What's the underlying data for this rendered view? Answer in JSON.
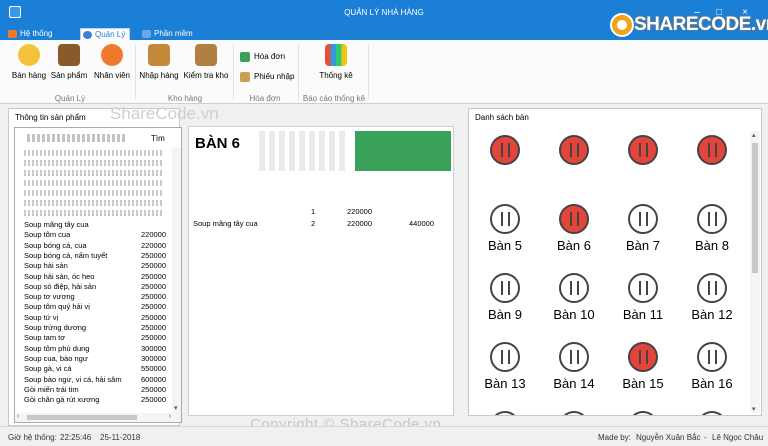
{
  "window": {
    "title": "QUẢN LÝ NHÀ HÀNG",
    "controls": [
      "–",
      "□",
      "×"
    ]
  },
  "logo": {
    "text": "SHARECODE.vn"
  },
  "tabs": [
    {
      "label": "Hệ thống",
      "active": false,
      "color": "#f07a2a"
    },
    {
      "label": "Quản Lý",
      "active": true,
      "color": "#3d7fd6"
    },
    {
      "label": "Phần mềm",
      "active": false,
      "color": "#6aa8e6"
    }
  ],
  "ribbon": {
    "groups": [
      {
        "label": "Quản Lý"
      },
      {
        "label": "Kho hàng"
      },
      {
        "label": "Hóa đơn"
      },
      {
        "label": "Báo cáo thống kê"
      }
    ],
    "buttons": {
      "sell": "Bán hàng",
      "product": "Sản phẩm",
      "staff": "Nhân viên",
      "import": "Nhập hàng",
      "stock": "Kiểm tra kho",
      "invoice": "Hóa đơn",
      "receipt": "Phiếu nhập",
      "stats": "Thống kê"
    }
  },
  "product_panel": {
    "title": "Thông tin sản phẩm",
    "search_button": "Tìm",
    "products": [
      {
        "name": "Soup mãng tây cua",
        "price": ""
      },
      {
        "name": "Soup tôm cua",
        "price": "220000"
      },
      {
        "name": "Soup bóng cá, cua",
        "price": "220000"
      },
      {
        "name": "Soup bóng cá, nấm tuyết",
        "price": "250000"
      },
      {
        "name": "Soup hải sản",
        "price": "250000"
      },
      {
        "name": "Soup hải sản, óc heo",
        "price": "250000"
      },
      {
        "name": "Soup sò điệp, hải sản",
        "price": "250000"
      },
      {
        "name": "Soup tơ vương",
        "price": "250000"
      },
      {
        "name": "Soup tôm quý hải vị",
        "price": "250000"
      },
      {
        "name": "Soup tứ vị",
        "price": "250000"
      },
      {
        "name": "Soup trứng dương",
        "price": "250000"
      },
      {
        "name": "Soup tam tơ",
        "price": "250000"
      },
      {
        "name": "Soup tôm phù dung",
        "price": "300000"
      },
      {
        "name": "Soup cua, bào ngư",
        "price": "300000"
      },
      {
        "name": "Soup gà, vi cá",
        "price": "550000"
      },
      {
        "name": "Soup bào ngư, vi cá, hải sâm",
        "price": "600000"
      },
      {
        "name": "Gỏi miến trái tim",
        "price": "250000"
      },
      {
        "name": "Gỏi chân gà rút xương",
        "price": "250000"
      }
    ]
  },
  "order": {
    "table_name": "BÀN 6",
    "rows": [
      {
        "name": "",
        "qty": "1",
        "price": "220000",
        "total": ""
      },
      {
        "name": "Soup mãng tây cua",
        "qty": "2",
        "price": "220000",
        "total": "440000"
      }
    ]
  },
  "tables_panel": {
    "title": "Danh sách bàn",
    "tables": [
      {
        "label": "",
        "busy": true
      },
      {
        "label": "",
        "busy": true
      },
      {
        "label": "",
        "busy": true
      },
      {
        "label": "",
        "busy": true
      },
      {
        "label": "Bàn 5",
        "busy": false
      },
      {
        "label": "Bàn 6",
        "busy": true
      },
      {
        "label": "Bàn 7",
        "busy": false
      },
      {
        "label": "Bàn 8",
        "busy": false
      },
      {
        "label": "Bàn 9",
        "busy": false
      },
      {
        "label": "Bàn 10",
        "busy": false
      },
      {
        "label": "Bàn 11",
        "busy": false
      },
      {
        "label": "Bàn 12",
        "busy": false
      },
      {
        "label": "Bàn 13",
        "busy": false
      },
      {
        "label": "Bàn 14",
        "busy": false
      },
      {
        "label": "Bàn 15",
        "busy": true
      },
      {
        "label": "Bàn 16",
        "busy": false
      }
    ]
  },
  "watermark": "Copyright © ShareCode.vn",
  "watermark_top": "ShareCode.vn",
  "status": {
    "time_label": "Giờ hệ thống:",
    "time": "22:25:46",
    "date": "25-11-2018",
    "made_by_label": "Made by:",
    "author1": "Nguyễn Xuân Bắc",
    "separator": "-",
    "author2": "Lê Ngọc Châu"
  }
}
